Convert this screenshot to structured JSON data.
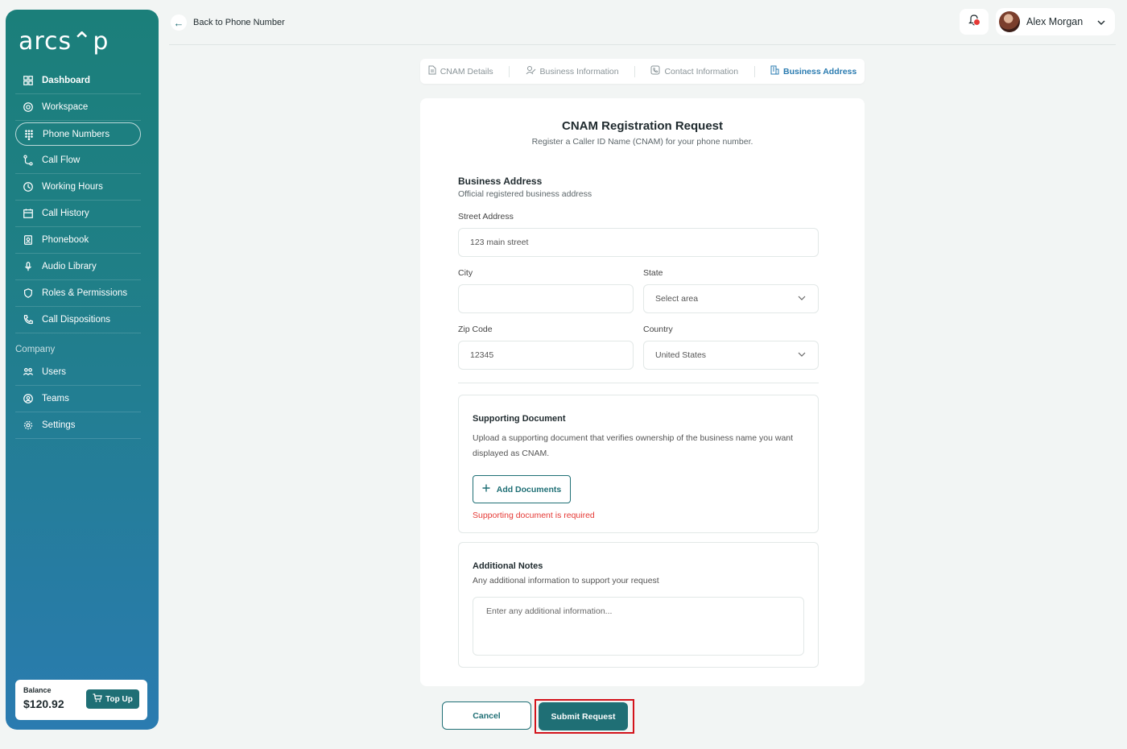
{
  "brand": {
    "logo_text": "arcs⌃p"
  },
  "sidebar": {
    "items": [
      {
        "label": "Dashboard",
        "icon": "grid-icon"
      },
      {
        "label": "Workspace",
        "icon": "lifebuoy-icon"
      },
      {
        "label": "Phone Numbers",
        "icon": "dialpad-icon"
      },
      {
        "label": "Call Flow",
        "icon": "flow-icon"
      },
      {
        "label": "Working Hours",
        "icon": "clock-icon"
      },
      {
        "label": "Call History",
        "icon": "calendar-icon"
      },
      {
        "label": "Phonebook",
        "icon": "contact-book-icon"
      },
      {
        "label": "Audio Library",
        "icon": "microphone-icon"
      },
      {
        "label": "Roles & Permissions",
        "icon": "shield-icon"
      },
      {
        "label": "Call Dispositions",
        "icon": "phone-icon"
      }
    ],
    "section_label": "Company",
    "company_items": [
      {
        "label": "Users",
        "icon": "users-icon"
      },
      {
        "label": "Teams",
        "icon": "team-icon"
      },
      {
        "label": "Settings",
        "icon": "gear-icon"
      }
    ],
    "balance": {
      "label": "Balance",
      "value": "$120.92",
      "topup_label": "Top Up"
    }
  },
  "header": {
    "back_label": "Back to Phone Number",
    "user_name": "Alex Morgan"
  },
  "stepper": {
    "steps": [
      "CNAM Details",
      "Business Information",
      "Contact Information",
      "Business Address"
    ],
    "active": "Business Address"
  },
  "form": {
    "title": "CNAM Registration Request",
    "subtitle": "Register a Caller ID Name (CNAM) for your phone number.",
    "section_title": "Business Address",
    "section_subtitle": "Official registered business address",
    "street": {
      "label": "Street Address",
      "value": "123 main street"
    },
    "city": {
      "label": "City",
      "value": ""
    },
    "state": {
      "label": "State",
      "value": "Select area"
    },
    "zip": {
      "label": "Zip Code",
      "value": "12345"
    },
    "country": {
      "label": "Country",
      "value": "United States"
    },
    "supporting": {
      "title": "Supporting Document",
      "text": "Upload a supporting document that verifies ownership of the business name you want displayed as CNAM.",
      "button": "Add Documents",
      "error": "Supporting document is required"
    },
    "notes": {
      "title": "Additional Notes",
      "subtitle": "Any additional information to support your request",
      "placeholder": "Enter any additional information..."
    }
  },
  "actions": {
    "cancel": "Cancel",
    "submit": "Submit Request"
  },
  "colors": {
    "accent": "#1f6f75",
    "active_step": "#2a7bb0",
    "error": "#e53935",
    "highlight": "#d3131b"
  }
}
